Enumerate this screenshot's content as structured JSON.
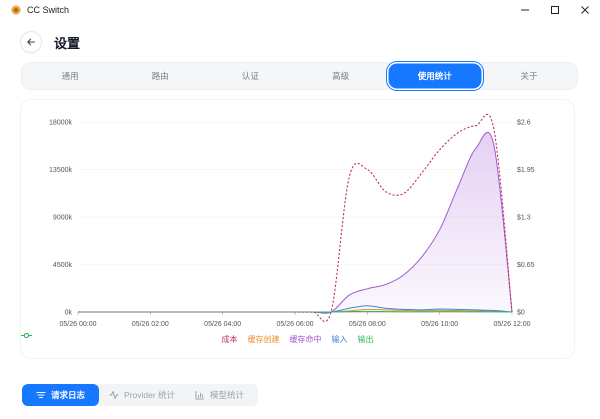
{
  "window": {
    "title": "CC Switch"
  },
  "header": {
    "title": "设置"
  },
  "tabs": [
    {
      "label": "通用"
    },
    {
      "label": "路由"
    },
    {
      "label": "认证"
    },
    {
      "label": "高级"
    },
    {
      "label": "使用统计",
      "active": true
    },
    {
      "label": "关于"
    }
  ],
  "subtabs": [
    {
      "label": "请求日志",
      "icon": "list-icon",
      "active": true
    },
    {
      "label": "Provider 统计",
      "icon": "activity-icon"
    },
    {
      "label": "模型统计",
      "icon": "bar-chart-icon"
    }
  ],
  "colors": {
    "accent": "#1677ff",
    "cost": "#c0355e",
    "cache_create": "#f08c2b",
    "cache_hit": "#a15ad6",
    "input": "#3f82e0",
    "output": "#2fb85a"
  },
  "chart_data": {
    "type": "area",
    "x": [
      "00:00",
      "00:30",
      "01:00",
      "01:30",
      "02:00",
      "02:30",
      "03:00",
      "03:30",
      "04:00",
      "04:30",
      "05:00",
      "05:30",
      "06:00",
      "06:30",
      "07:00",
      "07:30",
      "08:00",
      "08:30",
      "09:00",
      "09:30",
      "10:00",
      "10:30",
      "11:00",
      "11:30",
      "12:00"
    ],
    "x_tick_labels": [
      "05/26 00:00",
      "05/26 02:00",
      "05/26 04:00",
      "05/26 06:00",
      "05/26 08:00",
      "05/26 10:00",
      "05/26 12:00"
    ],
    "y_left_ticks": [
      "0k",
      "4500k",
      "9000k",
      "13500k",
      "18000k"
    ],
    "y_left_range": [
      0,
      18000
    ],
    "y_left_unit": "k",
    "y_right_ticks": [
      "$0",
      "$0.65",
      "$1.3",
      "$1.95",
      "$2.6"
    ],
    "y_right_range": [
      0,
      2.6
    ],
    "series": [
      {
        "name": "成本",
        "axis": "right",
        "style": "dashed",
        "values": [
          0,
          0,
          0,
          0,
          0,
          0,
          0,
          0,
          0,
          0,
          0,
          0,
          0,
          0,
          0.01,
          1.85,
          1.95,
          1.65,
          1.62,
          1.9,
          2.22,
          2.45,
          2.55,
          2.5,
          0
        ]
      },
      {
        "name": "缓存创建",
        "axis": "left",
        "style": "line",
        "values": [
          0,
          0,
          0,
          0,
          0,
          0,
          0,
          0,
          0,
          0,
          0,
          0,
          0,
          0,
          0,
          100,
          250,
          200,
          150,
          120,
          150,
          140,
          100,
          60,
          0
        ]
      },
      {
        "name": "缓存命中",
        "axis": "left",
        "style": "area",
        "values": [
          0,
          0,
          0,
          0,
          0,
          0,
          0,
          0,
          0,
          0,
          0,
          0,
          0,
          0,
          0,
          1600,
          2200,
          2600,
          3500,
          5200,
          7800,
          11800,
          15500,
          15800,
          0
        ]
      },
      {
        "name": "输入",
        "axis": "left",
        "style": "line",
        "values": [
          0,
          0,
          0,
          0,
          0,
          0,
          0,
          0,
          0,
          0,
          0,
          0,
          0,
          0,
          0,
          350,
          600,
          350,
          250,
          200,
          280,
          250,
          200,
          150,
          0
        ]
      },
      {
        "name": "输出",
        "axis": "left",
        "style": "line",
        "values": [
          0,
          0,
          0,
          0,
          0,
          0,
          0,
          0,
          0,
          0,
          0,
          0,
          0,
          0,
          0,
          40,
          60,
          40,
          30,
          30,
          40,
          40,
          30,
          20,
          0
        ]
      }
    ]
  }
}
